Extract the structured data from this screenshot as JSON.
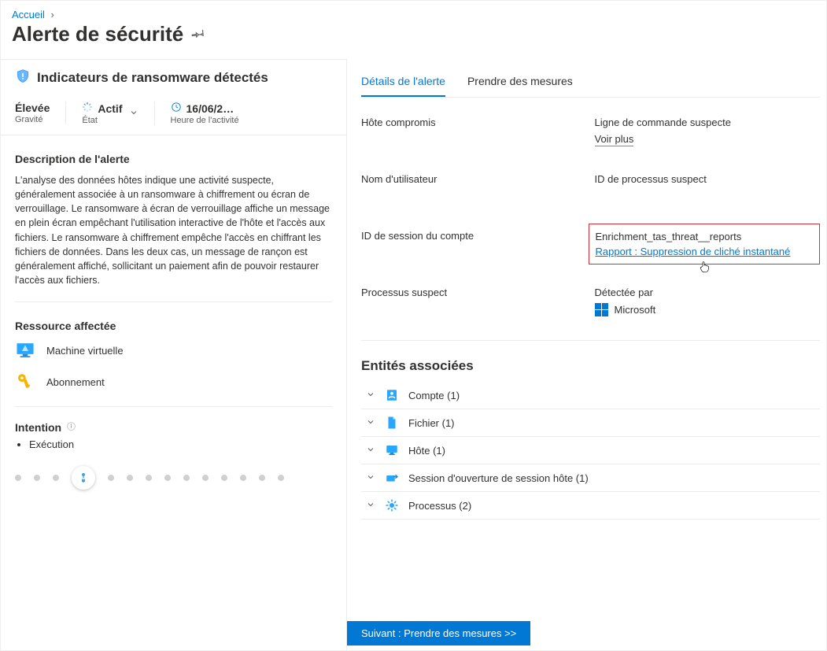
{
  "breadcrumb": {
    "home": "Accueil"
  },
  "page_title": "Alerte de sécurité",
  "alert": {
    "title": "Indicateurs de ransomware détectés",
    "severity_value": "Élevée",
    "severity_label": "Gravité",
    "state_value": "Actif",
    "state_label": "État",
    "time_value": "16/06/2…",
    "time_label": "Heure de l'activité"
  },
  "left": {
    "desc_title": "Description de l'alerte",
    "desc_text": "L'analyse des données hôtes indique une activité suspecte, généralement associée à un ransomware à chiffrement ou écran de verrouillage. Le ransomware à écran de verrouillage affiche un message en plein écran empêchant l'utilisation interactive de l'hôte et l'accès aux fichiers. Le ransomware à chiffrement empêche l'accès en chiffrant les fichiers de données. Dans les deux cas, un message de rançon est généralement affiché, sollicitant un paiement afin de pouvoir restaurer l'accès aux fichiers.",
    "resource_title": "Ressource affectée",
    "resource_vm": "Machine virtuelle",
    "resource_sub": "Abonnement",
    "intention_title": "Intention",
    "intention_item": "Exécution"
  },
  "tabs": {
    "details": "Détails de l'alerte",
    "actions": "Prendre des mesures"
  },
  "details": {
    "host_label": "Hôte compromis",
    "cmd_label": "Ligne de commande suspecte",
    "voir_plus": "Voir plus",
    "user_label": "Nom d'utilisateur",
    "pid_label": "ID de processus suspect",
    "session_label": "ID de session du compte",
    "enrich_label": "Enrichment_tas_threat__reports",
    "enrich_link": "Rapport : Suppression de cliché instantané",
    "proc_label": "Processus suspect",
    "detected_label": "Détectée par",
    "detected_by": "Microsoft"
  },
  "entities": {
    "title": "Entités associées",
    "rows": [
      {
        "label": "Compte (1)"
      },
      {
        "label": "Fichier (1)"
      },
      {
        "label": "Hôte (1)"
      },
      {
        "label": "Session d'ouverture de session hôte (1)"
      },
      {
        "label": "Processus (2)"
      }
    ]
  },
  "next_button": "Suivant : Prendre des mesures  >>"
}
